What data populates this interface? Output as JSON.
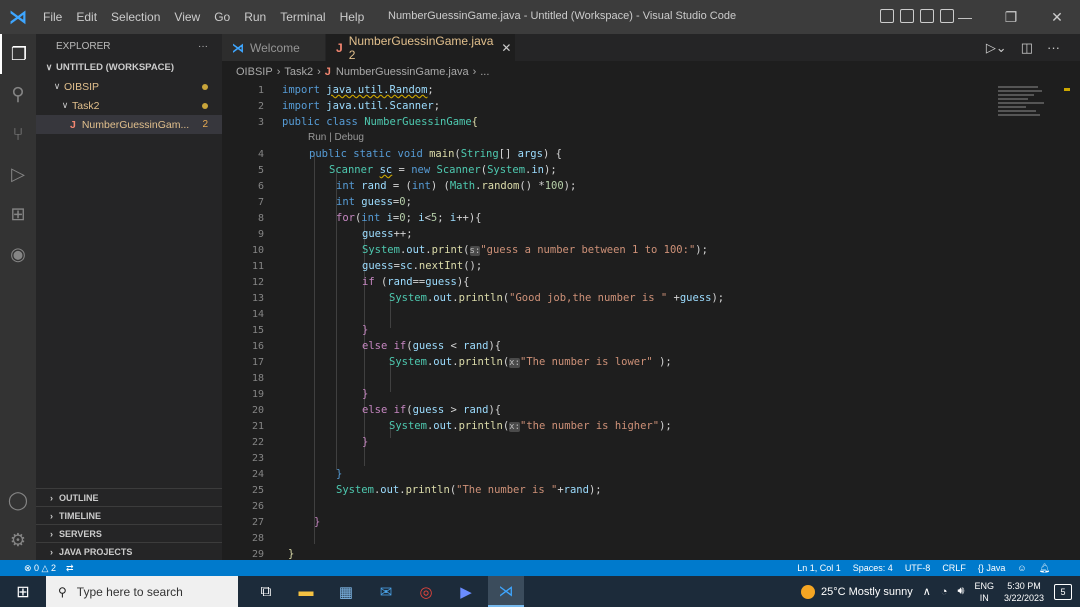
{
  "titlebar": {
    "menu": [
      "File",
      "Edit",
      "Selection",
      "View",
      "Go",
      "Run",
      "Terminal",
      "Help"
    ],
    "window_title": "NumberGuessinGame.java - Untitled (Workspace) - Visual Studio Code"
  },
  "sidebar": {
    "header": "EXPLORER",
    "more": "···",
    "workspace": "UNTITLED (WORKSPACE)",
    "folder1": "OIBSIP",
    "folder2": "Task2",
    "file": "NumberGuessinGam...",
    "file_badge": "2",
    "file_icon": "J",
    "sections": [
      "OUTLINE",
      "TIMELINE",
      "SERVERS",
      "JAVA PROJECTS"
    ]
  },
  "tabs": [
    {
      "icon": "⋊",
      "label": "Welcome"
    },
    {
      "icon": "J",
      "label": "NumberGuessinGame.java 2",
      "close": "✕"
    }
  ],
  "breadcrumb": [
    "OIBSIP",
    "Task2",
    "NumberGuessinGame.java",
    "..."
  ],
  "codelens": "Run | Debug",
  "line_numbers": [
    "1",
    "2",
    "3",
    "4",
    "5",
    "6",
    "7",
    "8",
    "9",
    "10",
    "11",
    "12",
    "13",
    "14",
    "15",
    "16",
    "17",
    "18",
    "19",
    "20",
    "21",
    "22",
    "23",
    "24",
    "25",
    "26",
    "27",
    "28",
    "29"
  ],
  "code": {
    "l1_kw": "import ",
    "l1_pkg": "java.util.Random",
    "l1_end": ";",
    "l2_kw": "import ",
    "l2_pkg": "java.util.Scanner",
    "l2_end": ";",
    "l3_kw": "public class ",
    "l3_cls": "NumberGuessinGame",
    "l3_end": "{",
    "l4_kw": "public static void ",
    "l4_fn": "main",
    "l4_a": "(",
    "l4_ty": "String",
    "l4_b": "[] ",
    "l4_va": "args",
    "l4_end": ") {",
    "l5_ty": "Scanner ",
    "l5_va": "sc",
    "l5_a": " = ",
    "l5_kw": "new ",
    "l5_ty2": "Scanner",
    "l5_b": "(",
    "l5_ty3": "System",
    "l5_c": ".",
    "l5_va2": "in",
    "l5_end": ");",
    "l6_kw": "int ",
    "l6_va": "rand",
    "l6_a": " = (",
    "l6_kw2": "int",
    "l6_b": ") (",
    "l6_ty": "Math",
    "l6_c": ".",
    "l6_fn": "random",
    "l6_d": "() *",
    "l6_nu": "100",
    "l6_end": ");",
    "l7_kw": "int ",
    "l7_va": "guess",
    "l7_a": "=",
    "l7_nu": "0",
    "l7_end": ";",
    "l8_ctl": "for",
    "l8_a": "(",
    "l8_kw": "int ",
    "l8_va": "i",
    "l8_b": "=",
    "l8_nu": "0",
    "l8_c": "; ",
    "l8_va2": "i",
    "l8_d": "<",
    "l8_nu2": "5",
    "l8_e": "; ",
    "l8_va3": "i",
    "l8_end": "++){",
    "l9_va": "guess",
    "l9_end": "++;",
    "l10_ty": "System",
    "l10_a": ".",
    "l10_va": "out",
    "l10_b": ".",
    "l10_fn": "print",
    "l10_c": "(",
    "l10_hint": "s:",
    "l10_st": "\"guess a number between 1 to 100:\"",
    "l10_end": ");",
    "l11_va": "guess",
    "l11_a": "=",
    "l11_va2": "sc",
    "l11_b": ".",
    "l11_fn": "nextInt",
    "l11_end": "();",
    "l12_ctl": "if ",
    "l12_a": "(",
    "l12_va": "rand",
    "l12_b": "==",
    "l12_va2": "guess",
    "l12_end": "){",
    "l13_ty": "System",
    "l13_a": ".",
    "l13_va": "out",
    "l13_b": ".",
    "l13_fn": "println",
    "l13_c": "(",
    "l13_st": "\"Good job,the number is \"",
    "l13_d": " +",
    "l13_va2": "guess",
    "l13_end": ");",
    "l15": "}",
    "l16_ctl": "else if",
    "l16_a": "(",
    "l16_va": "guess",
    "l16_b": " < ",
    "l16_va2": "rand",
    "l16_end": "){",
    "l17_ty": "System",
    "l17_a": ".",
    "l17_va": "out",
    "l17_b": ".",
    "l17_fn": "println",
    "l17_c": "(",
    "l17_hint": "x:",
    "l17_st": "\"The number is lower\"",
    "l17_end": " );",
    "l19": "}",
    "l20_ctl": "else if",
    "l20_a": "(",
    "l20_va": "guess",
    "l20_b": " > ",
    "l20_va2": "rand",
    "l20_end": "){",
    "l21_ty": "System",
    "l21_a": ".",
    "l21_va": "out",
    "l21_b": ".",
    "l21_fn": "println",
    "l21_c": "(",
    "l21_hint": "x:",
    "l21_st": "\"the number is higher\"",
    "l21_end": ");",
    "l22": "}",
    "l24": "}",
    "l25_ty": "System",
    "l25_a": ".",
    "l25_va": "out",
    "l25_b": ".",
    "l25_fn": "println",
    "l25_c": "(",
    "l25_st": "\"The number is \"",
    "l25_d": "+",
    "l25_va2": "rand",
    "l25_end": ");",
    "l27": "}",
    "l29": "}"
  },
  "statusbar": {
    "problems": "⊗ 0 △ 2",
    "position": "Ln 1, Col 1",
    "spaces": "Spaces: 4",
    "encoding": "UTF-8",
    "eol": "CRLF",
    "language": "{} Java"
  },
  "taskbar": {
    "search_placeholder": "Type here to search",
    "weather": "25°C  Mostly sunny",
    "lang_top": "ENG",
    "lang_bottom": "IN",
    "time": "5:30 PM",
    "date": "3/22/2023",
    "notif_count": "5"
  },
  "colors": {
    "accent": "#007acc",
    "keyword": "#569cd6",
    "control": "#c586c0",
    "type": "#4ec9b0",
    "function": "#dcdcaa",
    "variable": "#9cdcfe",
    "string": "#ce9178",
    "number": "#b5cea8"
  }
}
